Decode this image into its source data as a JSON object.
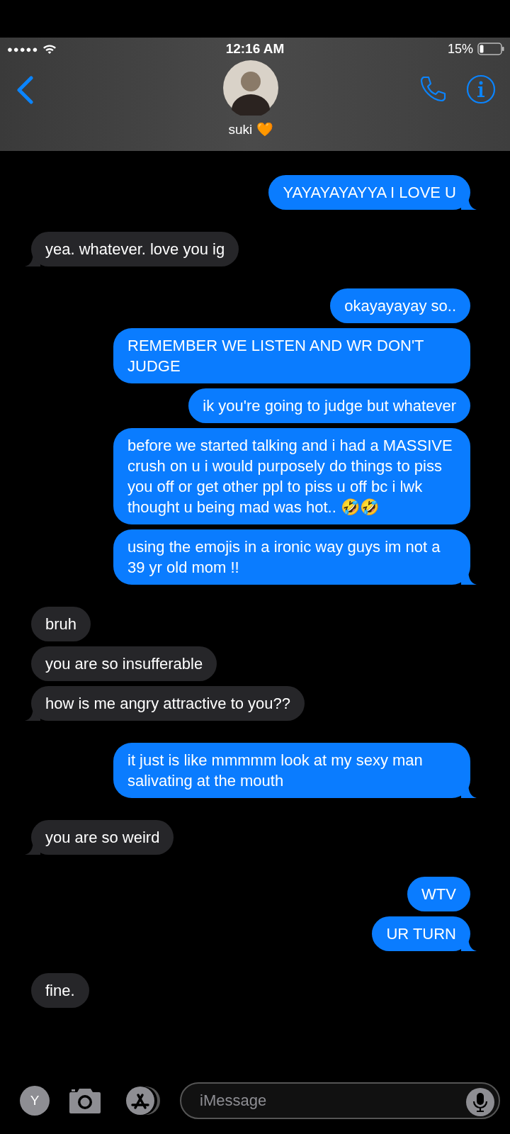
{
  "status_bar": {
    "signal_dots": "●●●●●",
    "time": "12:16 AM",
    "battery_text": "15%"
  },
  "contact": {
    "name": "suki 🧡"
  },
  "messages": [
    {
      "kind": "sent",
      "text": "YAYAYAYAYYA I LOVE U",
      "tail": true
    },
    {
      "kind": "received",
      "text": "yea. whatever. love you ig",
      "tail": true
    },
    {
      "kind": "sent",
      "text": "okayayayay so..",
      "tail": false
    },
    {
      "kind": "sent",
      "text": "REMEMBER WE LISTEN AND WR DON'T JUDGE",
      "tail": false
    },
    {
      "kind": "sent",
      "text": "ik you're going to judge but whatever",
      "tail": false
    },
    {
      "kind": "sent",
      "text": "before we started talking and i had a MASSIVE crush on u i would purposely do things to piss you off or get other ppl to piss u off bc i lwk thought u being mad was hot.. 🤣🤣",
      "tail": false
    },
    {
      "kind": "sent",
      "text": "using the emojis in a ironic way guys im not a 39 yr old mom !!",
      "tail": true
    },
    {
      "kind": "received",
      "text": "bruh",
      "tail": false
    },
    {
      "kind": "received",
      "text": "you are so insufferable",
      "tail": false
    },
    {
      "kind": "received",
      "text": "how is me angry attractive to you??",
      "tail": true
    },
    {
      "kind": "sent",
      "text": "it just is like mmmmm look at my sexy man salivating at the mouth",
      "tail": true
    },
    {
      "kind": "received",
      "text": "you are so weird",
      "tail": true
    },
    {
      "kind": "sent",
      "text": "WTV",
      "tail": false
    },
    {
      "kind": "sent",
      "text": "UR TURN",
      "tail": true
    },
    {
      "kind": "received",
      "text": "fine.",
      "tail": false
    }
  ],
  "composer": {
    "apps_initial": "Y",
    "placeholder": "iMessage"
  }
}
